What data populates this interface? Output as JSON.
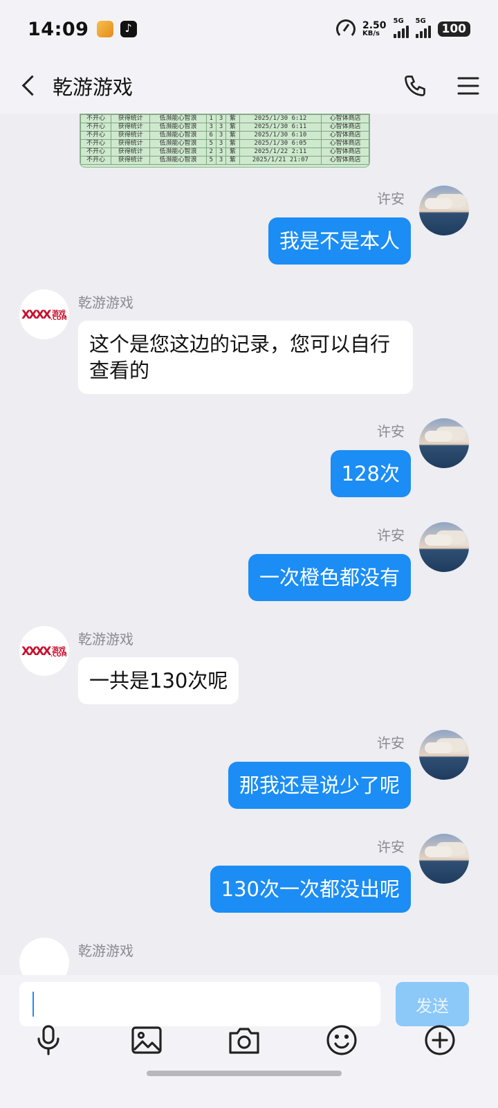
{
  "status_bar": {
    "time": "14:09",
    "net_speed_value": "2.50",
    "net_speed_unit": "KB/s",
    "signal1_label": "5G",
    "signal2_label": "5G",
    "battery": "100",
    "icons": [
      "app-icon",
      "tiktok-icon",
      "speed-icon",
      "signal-icon",
      "signal-icon",
      "battery-icon"
    ]
  },
  "header": {
    "title": "乾游游戏",
    "icons": [
      "back-icon",
      "phone-icon",
      "menu-icon"
    ]
  },
  "screenshot_rows": [
    [
      "不开心",
      "获得统计",
      "低濒能心智浪",
      "1",
      "3",
      "紫",
      "2025/1/30 6:12",
      "心智体商店"
    ],
    [
      "不开心",
      "获得统计",
      "低濒能心智浪",
      "3",
      "3",
      "紫",
      "2025/1/30 6:11",
      "心智体商店"
    ],
    [
      "不开心",
      "获得统计",
      "低濒能心智浪",
      "6",
      "3",
      "紫",
      "2025/1/30 6:10",
      "心智体商店"
    ],
    [
      "不开心",
      "获得统计",
      "低濒能心智浪",
      "5",
      "3",
      "紫",
      "2025/1/30 6:05",
      "心智体商店"
    ],
    [
      "不开心",
      "获得统计",
      "低濒能心智浪",
      "2",
      "3",
      "紫",
      "2025/1/22 2:11",
      "心智体商店"
    ],
    [
      "不开心",
      "获得统计",
      "低濒能心智浪",
      "5",
      "3",
      "紫",
      "2025/1/21 21:07",
      "心智体商店"
    ]
  ],
  "messages": [
    {
      "sender": "许安",
      "text": "我是不是本人",
      "direction": "out"
    },
    {
      "sender": "乾游游戏",
      "text": "这个是您这边的记录，您可以自行查看的",
      "direction": "in"
    },
    {
      "sender": "许安",
      "text": "128次",
      "direction": "out"
    },
    {
      "sender": "许安",
      "text": "一次橙色都没有",
      "direction": "out"
    },
    {
      "sender": "乾游游戏",
      "text": "一共是130次呢",
      "direction": "in"
    },
    {
      "sender": "许安",
      "text": "那我还是说少了呢",
      "direction": "out"
    },
    {
      "sender": "许安",
      "text": "130次一次都没出呢",
      "direction": "out"
    },
    {
      "sender": "乾游游戏",
      "text": "",
      "direction": "in"
    }
  ],
  "logo": {
    "mark": "XXXX",
    "text_top": "游戏",
    "text_bottom": ".COM"
  },
  "input": {
    "value": "",
    "placeholder": ""
  },
  "send_label": "发送",
  "toolbar": [
    "microphone-icon",
    "image-icon",
    "camera-icon",
    "emoji-icon",
    "plus-icon"
  ],
  "colors": {
    "accent": "#1b8df4",
    "send_disabled": "#8cc8f8",
    "background": "#ededf2"
  }
}
